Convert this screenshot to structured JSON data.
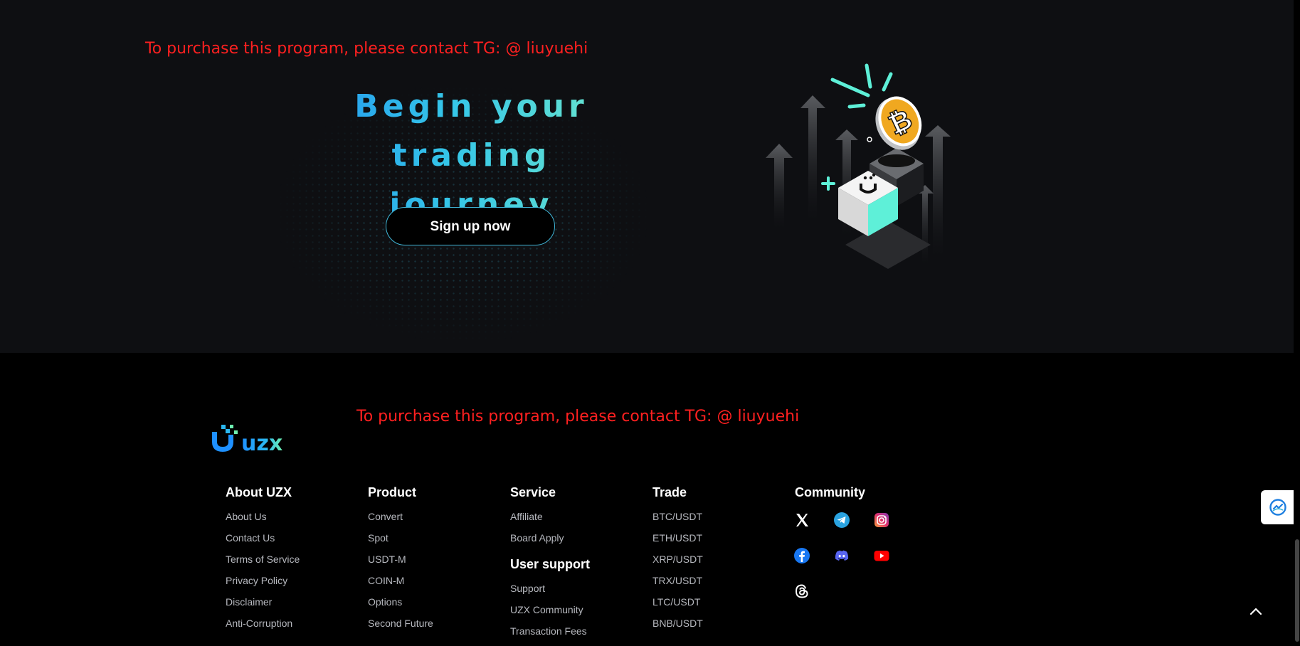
{
  "watermark": {
    "text": "To purchase this program, please contact TG: @ liuyuehi"
  },
  "hero": {
    "title_line1": "Begin your trading",
    "title_line2": "journey",
    "signup_label": "Sign up now"
  },
  "logo": {
    "text": "uzx"
  },
  "footer": {
    "about": {
      "title": "About UZX",
      "items": [
        "About Us",
        "Contact Us",
        "Terms of Service",
        "Privacy Policy",
        "Disclaimer",
        "Anti-Corruption"
      ]
    },
    "product": {
      "title": "Product",
      "items": [
        "Convert",
        "Spot",
        "USDT-M",
        "COIN-M",
        "Options",
        "Second Future"
      ]
    },
    "service": {
      "title": "Service",
      "items": [
        "Affiliate",
        "Board Apply"
      ]
    },
    "user_support": {
      "title": "User support",
      "items": [
        "Support",
        "UZX Community",
        "Transaction Fees"
      ]
    },
    "trade": {
      "title": "Trade",
      "items": [
        "BTC/USDT",
        "ETH/USDT",
        "XRP/USDT",
        "TRX/USDT",
        "LTC/USDT",
        "BNB/USDT"
      ]
    },
    "community": {
      "title": "Community",
      "icons": [
        "x-icon",
        "telegram-icon",
        "instagram-icon",
        "facebook-icon",
        "discord-icon",
        "youtube-icon",
        "threads-icon"
      ]
    }
  },
  "colors": {
    "accent": "#3fb6d8",
    "watermark": "#ff2020",
    "gradient_start": "#1f8df0",
    "gradient_end": "#7ef1c4"
  }
}
